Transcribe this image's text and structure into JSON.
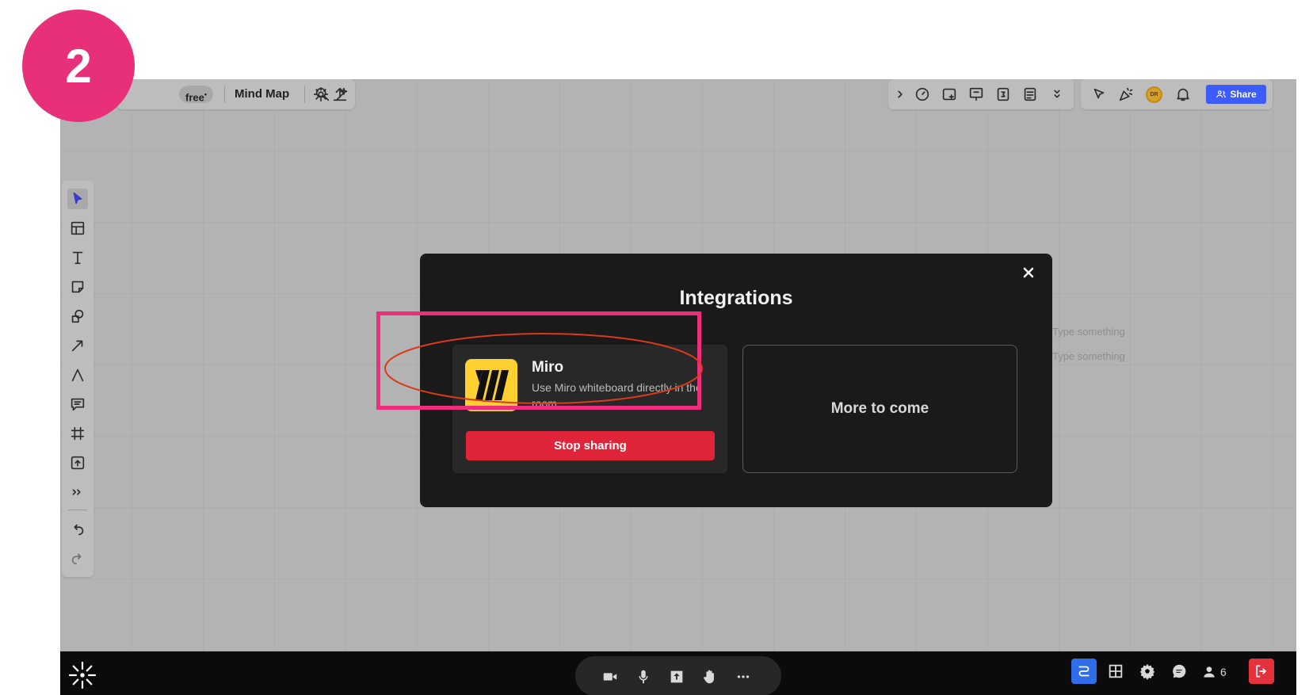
{
  "step_badge": "2",
  "topbar_left": {
    "plan_label": "free",
    "board_name": "Mind Map"
  },
  "topbar_right": {
    "avatar_initials": "DR",
    "share_label": "Share"
  },
  "modal": {
    "title": "Integrations",
    "miro": {
      "name": "Miro",
      "description": "Use Miro whiteboard directly in the room",
      "button_label": "Stop sharing"
    },
    "placeholder_label": "More to come"
  },
  "mindmap": {
    "node1": "Type something",
    "node2": "Type something"
  },
  "bottombar": {
    "participants_count": "6"
  },
  "colors": {
    "badge": "#e8307a",
    "highlight_rect": "#ee2d7c",
    "highlight_ellipse": "#d83a1a",
    "stop_button": "#e0243a",
    "share_button": "#3d5cff",
    "leave_button": "#e5323c",
    "miro_yellow": "#ffd02f"
  }
}
